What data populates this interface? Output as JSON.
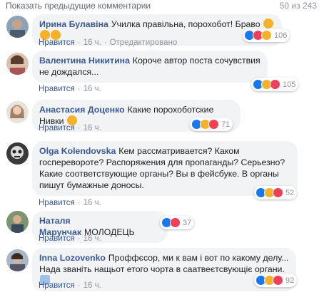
{
  "header": {
    "more_link": "Показать предыдущие комментарии",
    "count": "50 из 243"
  },
  "colors": {
    "like": "#1877f2",
    "haha": "#f7b125",
    "love": "#f33e58",
    "name": "#385898"
  },
  "comments": [
    {
      "author": "Ирина Булавіна",
      "text": "Училка правільна, порохобот! Браво",
      "like": "Нравится",
      "time": "16 ч.",
      "extra": "Отредактировано",
      "reactions": [
        "like",
        "love",
        "haha"
      ],
      "reaction_count": "106"
    },
    {
      "author": "Валентина Никитина",
      "text": "Короче автор поста сочувствия не дождался...",
      "like": "Нравится",
      "time": "16 ч.",
      "reactions": [
        "like",
        "haha",
        "love"
      ],
      "reaction_count": "105"
    },
    {
      "author": "Анастасия Доценко",
      "text": "Какие порохоботские Нивки",
      "like": "Нравится",
      "time": "16 ч.",
      "reactions": [
        "like",
        "haha",
        "love"
      ],
      "reaction_count": "71"
    },
    {
      "author": "Olga Kolendovska",
      "text": "Кем рассматривается? Каком госпереворотe? Распоряжения для пропаганды? Серьезно? Какие соответствующие органы? Вы в фейсбуке. В органы пишут бумажные доносы.",
      "like": "Нравится",
      "time": "16 ч.",
      "reactions": [
        "like",
        "haha",
        "love"
      ],
      "reaction_count": "52"
    },
    {
      "author": "Наталя Марунчак",
      "text": "МОЛОДЕЦЬ",
      "like": "Нравится",
      "time": "16 ч.",
      "reactions": [
        "like",
        "love"
      ],
      "reaction_count": "37"
    },
    {
      "author": "Inna Lozovenko",
      "text": "Проффєсор, ми к вам і вот по какому делу... Нада званіть нащьот етого чорта в саатвеєтсвующіє органи.",
      "like": "Нравится",
      "time": "16 ч.",
      "reactions": [
        "like",
        "haha",
        "love"
      ],
      "reaction_count": "92"
    }
  ]
}
